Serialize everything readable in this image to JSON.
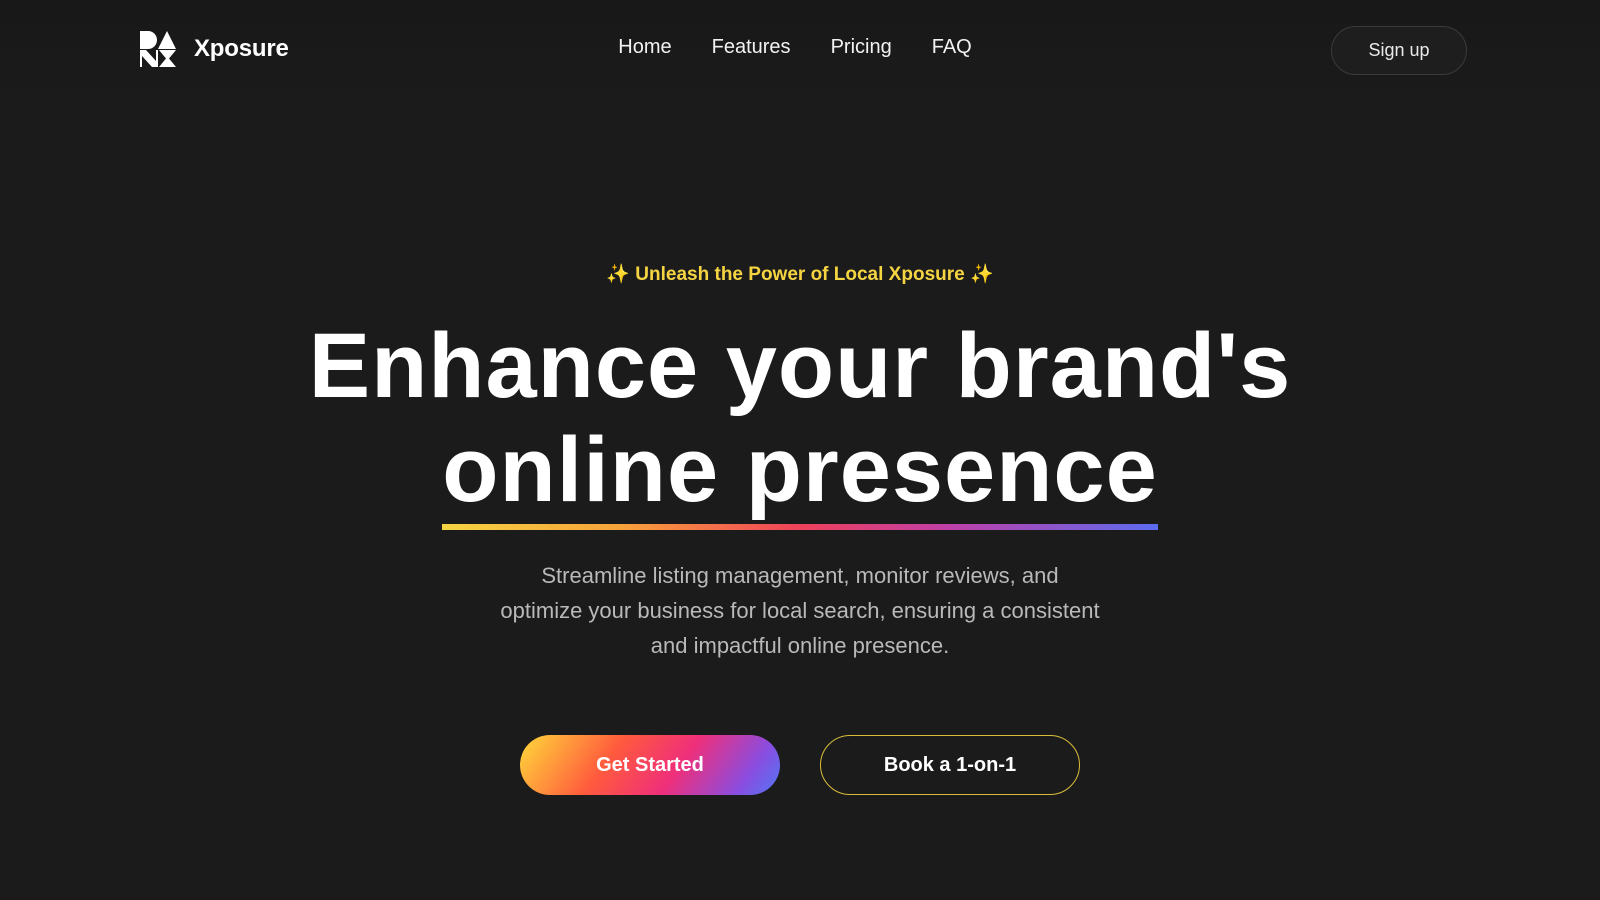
{
  "brand": {
    "name": "Xposure",
    "logo_icon": "geometric-shapes-logo"
  },
  "nav": {
    "items": [
      {
        "label": "Home"
      },
      {
        "label": "Features"
      },
      {
        "label": "Pricing"
      },
      {
        "label": "FAQ"
      }
    ]
  },
  "header": {
    "signup_label": "Sign up"
  },
  "hero": {
    "eyebrow": "✨ Unleash the Power of Local Xposure ✨",
    "headline_line1": "Enhance your brand's",
    "headline_line2": "online presence",
    "subtext": "Streamline listing management, monitor reviews, and optimize your business for local search, ensuring a consistent and impactful online presence.",
    "primary_cta": "Get Started",
    "secondary_cta": "Book a 1-on-1"
  },
  "colors": {
    "background": "#1b1b1b",
    "accent_yellow": "#f5d442",
    "gradient": [
      "#f5d442",
      "#f0415a",
      "#5b6cf0"
    ]
  }
}
